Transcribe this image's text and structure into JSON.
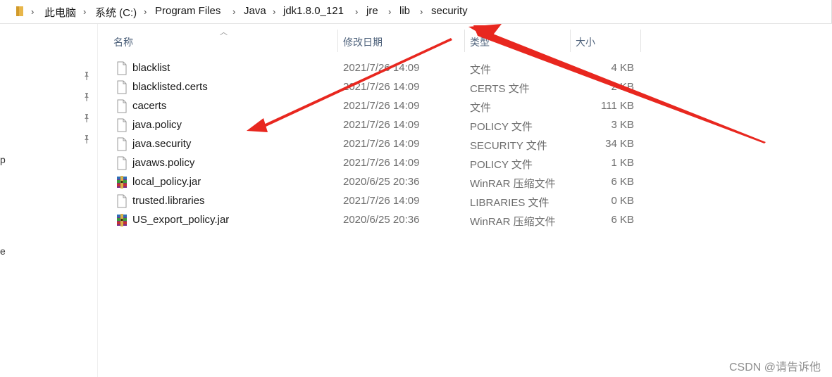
{
  "breadcrumb": {
    "items": [
      "此电脑",
      "系统 (C:)",
      "Program Files",
      "Java",
      "jdk1.8.0_121",
      "jre",
      "lib",
      "security"
    ]
  },
  "columns": {
    "name": "名称",
    "date": "修改日期",
    "type": "类型",
    "size": "大小"
  },
  "nav_cut_text": [
    "p",
    "e"
  ],
  "files": [
    {
      "name": "blacklist",
      "date": "2021/7/26 14:09",
      "type": "文件",
      "size": "4 KB",
      "icon": "file-icon"
    },
    {
      "name": "blacklisted.certs",
      "date": "2021/7/26 14:09",
      "type": "CERTS 文件",
      "size": "2 KB",
      "icon": "file-icon"
    },
    {
      "name": "cacerts",
      "date": "2021/7/26 14:09",
      "type": "文件",
      "size": "111 KB",
      "icon": "file-icon"
    },
    {
      "name": "java.policy",
      "date": "2021/7/26 14:09",
      "type": "POLICY 文件",
      "size": "3 KB",
      "icon": "file-icon"
    },
    {
      "name": "java.security",
      "date": "2021/7/26 14:09",
      "type": "SECURITY 文件",
      "size": "34 KB",
      "icon": "file-icon"
    },
    {
      "name": "javaws.policy",
      "date": "2021/7/26 14:09",
      "type": "POLICY 文件",
      "size": "1 KB",
      "icon": "file-icon"
    },
    {
      "name": "local_policy.jar",
      "date": "2020/6/25 20:36",
      "type": "WinRAR 压缩文件",
      "size": "6 KB",
      "icon": "winrar-icon"
    },
    {
      "name": "trusted.libraries",
      "date": "2021/7/26 14:09",
      "type": "LIBRARIES 文件",
      "size": "0 KB",
      "icon": "file-icon"
    },
    {
      "name": "US_export_policy.jar",
      "date": "2020/6/25 20:36",
      "type": "WinRAR 压缩文件",
      "size": "6 KB",
      "icon": "winrar-icon"
    }
  ],
  "watermark": "CSDN @请告诉他",
  "colors": {
    "annotation_arrow": "#e8271f",
    "header_text": "#4c607a",
    "secondary_text": "#6d6d6d"
  }
}
